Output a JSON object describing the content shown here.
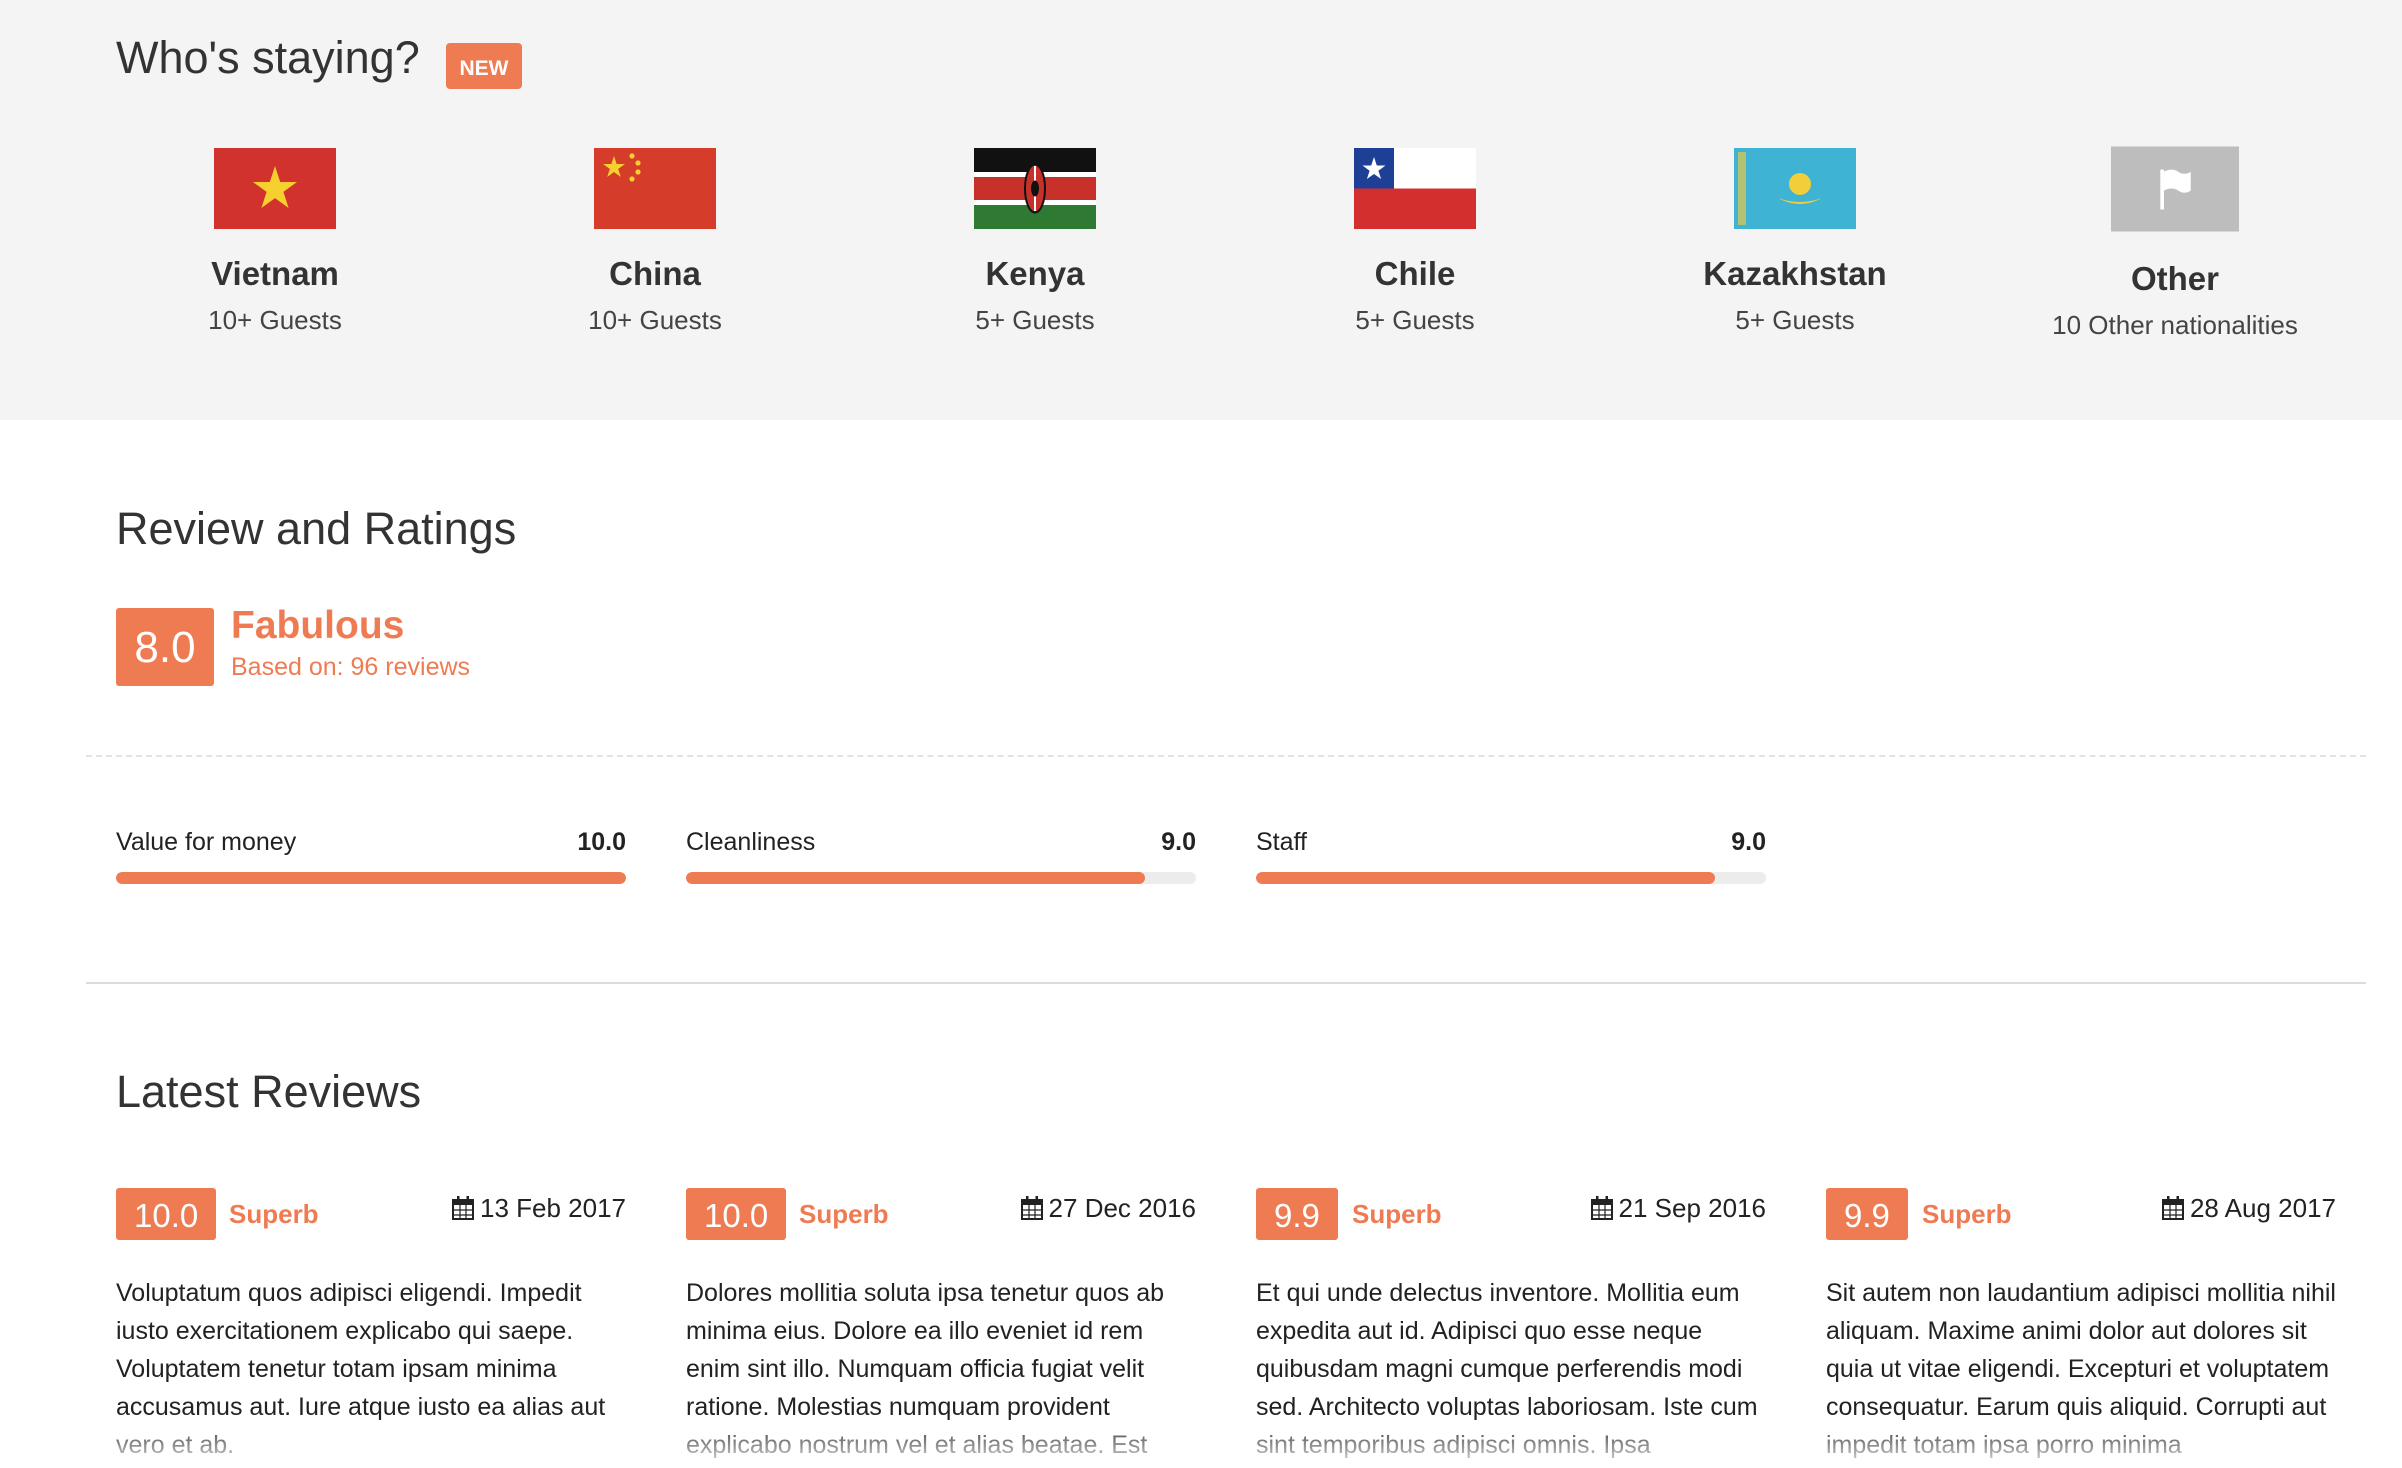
{
  "colors": {
    "accent": "#ef7b53",
    "top_bg": "#f4f4f4",
    "bar_track": "#ececec"
  },
  "whos_staying": {
    "title": "Who's staying?",
    "badge": "NEW",
    "nationalities": [
      {
        "name": "Vietnam",
        "guests": "10+ Guests",
        "icon": "vietnam-flag-icon"
      },
      {
        "name": "China",
        "guests": "10+ Guests",
        "icon": "china-flag-icon"
      },
      {
        "name": "Kenya",
        "guests": "5+ Guests",
        "icon": "kenya-flag-icon"
      },
      {
        "name": "Chile",
        "guests": "5+ Guests",
        "icon": "chile-flag-icon"
      },
      {
        "name": "Kazakhstan",
        "guests": "5+ Guests",
        "icon": "kazakhstan-flag-icon"
      },
      {
        "name": "Other",
        "guests": "10 Other nationalities",
        "icon": "generic-flag-icon"
      }
    ]
  },
  "ratings": {
    "title": "Review and Ratings",
    "score": "8.0",
    "word": "Fabulous",
    "basis": "Based on: 96 reviews",
    "bars": [
      {
        "label": "Value for money",
        "value": "10.0",
        "fraction": 1.0
      },
      {
        "label": "Cleanliness",
        "value": "9.0",
        "fraction": 0.9
      },
      {
        "label": "Staff",
        "value": "9.0",
        "fraction": 0.9
      }
    ]
  },
  "latest": {
    "title": "Latest Reviews",
    "reviews": [
      {
        "score": "10.0",
        "level": "Superb",
        "date": "13 Feb 2017",
        "text": "Voluptatum quos adipisci eligendi. Impedit iusto exercitationem explicabo qui saepe. Voluptatem tenetur totam ipsam minima accusamus aut. Iure atque iusto ea alias aut vero et ab."
      },
      {
        "score": "10.0",
        "level": "Superb",
        "date": "27 Dec 2016",
        "text": "Dolores mollitia soluta ipsa tenetur quos ab minima eius. Dolore ea illo eveniet id rem enim sint illo. Numquam officia fugiat velit ratione. Molestias numquam provident explicabo nostrum vel et alias beatae. Est"
      },
      {
        "score": "9.9",
        "level": "Superb",
        "date": "21 Sep 2016",
        "text": "Et qui unde delectus inventore. Mollitia eum expedita aut id. Adipisci quo esse neque quibusdam magni cumque perferendis modi sed. Architecto voluptas laboriosam. Iste cum sint temporibus adipisci omnis. Ipsa"
      },
      {
        "score": "9.9",
        "level": "Superb",
        "date": "28 Aug 2017",
        "text": "Sit autem non laudantium adipisci mollitia nihil aliquam. Maxime animi dolor aut dolores sit quia ut vitae eligendi. Excepturi et voluptatem consequatur. Earum quis aliquid. Corrupti aut impedit totam ipsa porro minima"
      }
    ]
  }
}
